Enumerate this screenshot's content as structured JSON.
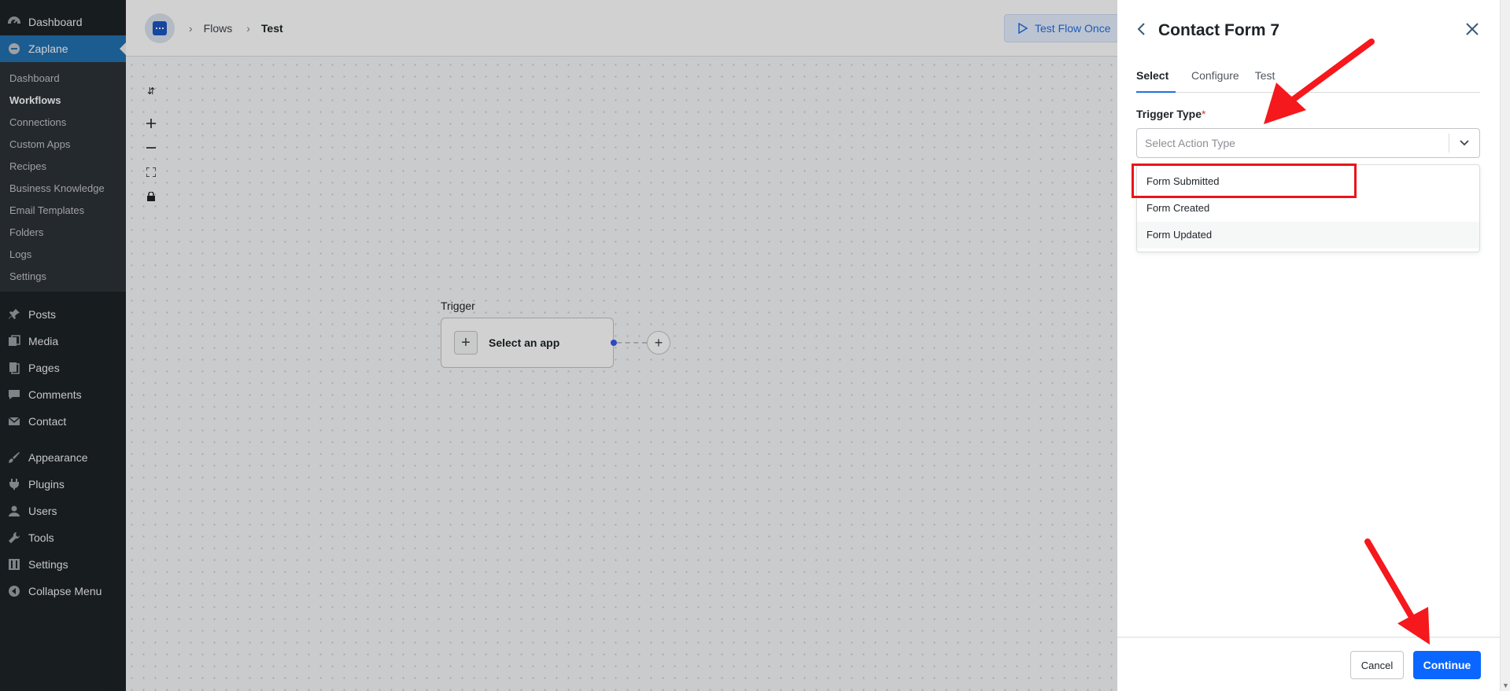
{
  "sidebar": {
    "top_items": [
      {
        "label": "Dashboard",
        "icon": "dashboard-icon"
      },
      {
        "label": "Zaplane",
        "icon": "zaplane-icon"
      }
    ],
    "submenu": [
      "Dashboard",
      "Workflows",
      "Connections",
      "Custom Apps",
      "Recipes",
      "Business Knowledge",
      "Email Templates",
      "Folders",
      "Logs",
      "Settings"
    ],
    "items": [
      {
        "label": "Posts",
        "icon": "pin-icon"
      },
      {
        "label": "Media",
        "icon": "media-icon"
      },
      {
        "label": "Pages",
        "icon": "pages-icon"
      },
      {
        "label": "Comments",
        "icon": "comment-icon"
      },
      {
        "label": "Contact",
        "icon": "mail-icon"
      }
    ],
    "items2": [
      {
        "label": "Appearance",
        "icon": "brush-icon"
      },
      {
        "label": "Plugins",
        "icon": "plugin-icon"
      },
      {
        "label": "Users",
        "icon": "user-icon"
      },
      {
        "label": "Tools",
        "icon": "wrench-icon"
      },
      {
        "label": "Settings",
        "icon": "settings-icon"
      },
      {
        "label": "Collapse Menu",
        "icon": "collapse-icon"
      }
    ]
  },
  "breadcrumb": {
    "level1": "Flows",
    "level2": "Test"
  },
  "toolbar": {
    "test_flow_label": "Test Flow Once"
  },
  "canvas": {
    "trigger_label": "Trigger",
    "node_label": "Select an app"
  },
  "panel": {
    "title": "Contact Form 7",
    "tabs": [
      "Select",
      "Configure",
      "Test"
    ],
    "field_label": "Trigger Type",
    "required_mark": "*",
    "select_placeholder": "Select Action Type",
    "options": [
      "Form Submitted",
      "Form Created",
      "Form Updated"
    ],
    "cancel_label": "Cancel",
    "continue_label": "Continue"
  },
  "colors": {
    "accent": "#0a66ff",
    "annotation": "#e8151a",
    "wp_active": "#2271b1"
  }
}
